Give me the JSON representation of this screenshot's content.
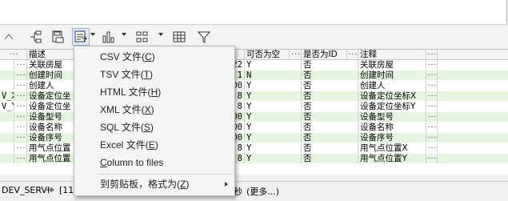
{
  "toolbar": {
    "buttons": [
      "up-arrow-icon",
      "tree-icon",
      "save-template-icon",
      "export-icon",
      "bar-chart-icon",
      "grid-layout-icon",
      "table-icon",
      "filter-icon"
    ]
  },
  "grid": {
    "headers": [
      "描述",
      "",
      "",
      "可否为空",
      "",
      "是否为ID",
      "",
      "注释",
      ""
    ],
    "rows": [
      {
        "prefix": "",
        "desc": "关联房屋",
        "size": "22",
        "nullable": "Y",
        "isid": "否",
        "comment": "关联房屋"
      },
      {
        "prefix": "",
        "desc": "创建时间",
        "size": "1",
        "nullable": "N",
        "isid": "否",
        "comment": "创建时间"
      },
      {
        "prefix": "",
        "desc": "创建人",
        "size": "00",
        "nullable": "Y",
        "isid": "否",
        "comment": "创建人"
      },
      {
        "prefix": "V_X",
        "desc": "设备定位坐",
        "size": "8",
        "nullable": "Y",
        "isid": "否",
        "comment": "设备定位坐标X"
      },
      {
        "prefix": "V_Y",
        "desc": "设备定位坐",
        "size": "8",
        "nullable": "Y",
        "isid": "否",
        "comment": "设备定位坐标Y"
      },
      {
        "prefix": "",
        "desc": "设备型号",
        "size": "00",
        "nullable": "Y",
        "isid": "否",
        "comment": "设备型号"
      },
      {
        "prefix": "",
        "desc": "设备名称",
        "size": "00",
        "nullable": "Y",
        "isid": "否",
        "comment": "设备名称"
      },
      {
        "prefix": "",
        "desc": "设备序号",
        "size": "00",
        "nullable": "Y",
        "isid": "否",
        "comment": "设备序号"
      },
      {
        "prefix": "",
        "desc": "用气点位置",
        "size": "8",
        "nullable": "Y",
        "isid": "否",
        "comment": "用气点位置X"
      },
      {
        "prefix": "",
        "desc": "用气点位置",
        "size": "8",
        "nullable": "Y",
        "isid": "否",
        "comment": "用气点位置Y"
      }
    ],
    "dots": "···"
  },
  "status": {
    "left": "DEV_SERVI",
    "mid": "[11",
    "sec": "秒",
    "more": "(更多...)"
  },
  "menu": {
    "items": [
      {
        "pre": "CSV 文件(",
        "key": "C",
        "post": ")"
      },
      {
        "pre": "TSV 文件(",
        "key": "T",
        "post": ")"
      },
      {
        "pre": "HTML 文件(",
        "key": "H",
        "post": ")"
      },
      {
        "pre": "XML 文件(",
        "key": "X",
        "post": ")"
      },
      {
        "pre": "SQL 文件(",
        "key": "S",
        "post": ")"
      },
      {
        "pre": "Excel 文件(",
        "key": "E",
        "post": ")"
      },
      {
        "pre": "",
        "key": "C",
        "post": "olumn to files"
      },
      {
        "pre": "到剪贴板，格式为(",
        "key": "Z",
        "post": ")"
      }
    ]
  }
}
